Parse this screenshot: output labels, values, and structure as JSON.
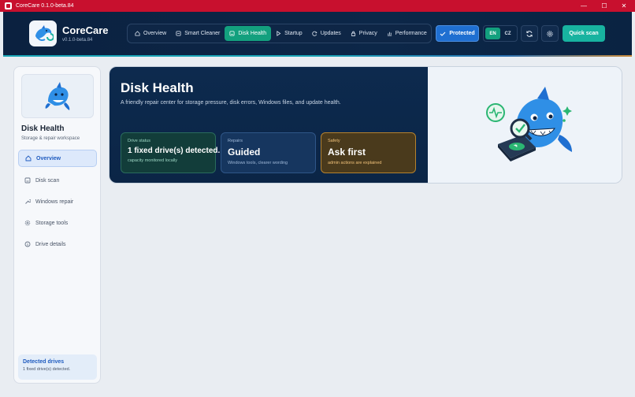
{
  "window": {
    "title": "CoreCare 0.1.0-beta.84",
    "controls": {
      "minimize": "—",
      "maximize": "☐",
      "close": "✕"
    }
  },
  "header": {
    "brand": "CoreCare",
    "version": "v0.1.0-beta.84",
    "nav": [
      {
        "label": "Overview",
        "icon": "home-icon"
      },
      {
        "label": "Smart Cleaner",
        "icon": "broom-icon"
      },
      {
        "label": "Disk Health",
        "icon": "disk-icon",
        "active": true
      },
      {
        "label": "Startup",
        "icon": "play-icon"
      },
      {
        "label": "Updates",
        "icon": "refresh-icon"
      },
      {
        "label": "Privacy",
        "icon": "lock-icon"
      },
      {
        "label": "Performance",
        "icon": "bar-chart-icon"
      }
    ],
    "protected_label": "Protected",
    "lang": {
      "en": "EN",
      "cz": "CZ"
    },
    "quick_scan": "Quick scan"
  },
  "sidebar": {
    "title": "Disk Health",
    "subtitle": "Storage & repair workspace",
    "items": [
      {
        "label": "Overview",
        "icon": "home-icon",
        "active": true
      },
      {
        "label": "Disk scan",
        "icon": "scan-icon"
      },
      {
        "label": "Windows repair",
        "icon": "wrench-icon"
      },
      {
        "label": "Storage tools",
        "icon": "gear-icon"
      },
      {
        "label": "Drive details",
        "icon": "info-icon"
      }
    ],
    "footer": {
      "title": "Detected drives",
      "detail": "1 fixed drive(s) detected."
    }
  },
  "hero": {
    "title": "Disk Health",
    "description": "A friendly repair center for storage pressure, disk errors, Windows files, and update health.",
    "cards": [
      {
        "label": "Drive status",
        "value": "1 fixed drive(s) detected.",
        "note": "capacity monitored locally"
      },
      {
        "label": "Repairs",
        "value": "Guided",
        "note": "Windows tools, clearer wording"
      },
      {
        "label": "Safety",
        "value": "Ask first",
        "note": "admin actions are explained"
      }
    ]
  },
  "colors": {
    "titlebar": "#c8102e",
    "header_bg": "#0b2140",
    "accent_green": "#13a07e",
    "protected_blue": "#1f6fd1",
    "quick_scan_teal": "#18b3a0"
  }
}
